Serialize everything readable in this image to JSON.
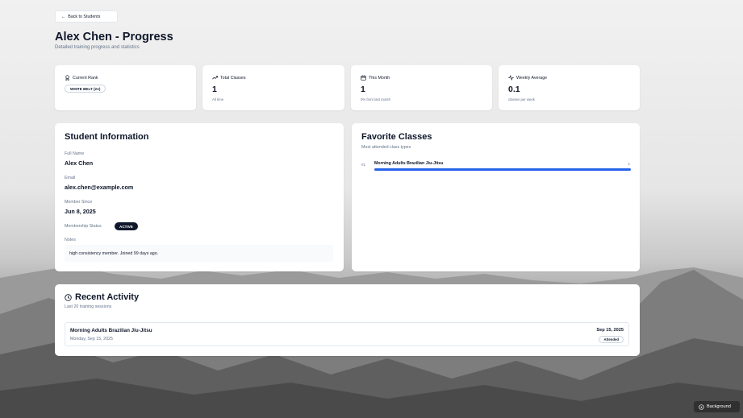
{
  "nav": {
    "back_label": "Back to Students"
  },
  "header": {
    "title": "Alex Chen - Progress",
    "subtitle": "Detailed training progress and statistics"
  },
  "stats": {
    "rank": {
      "title": "Current Rank",
      "badge": "WHITE BELT (2●)"
    },
    "total_classes": {
      "title": "Total Classes",
      "value": "1",
      "note": "All time"
    },
    "this_month": {
      "title": "This Month",
      "value": "1",
      "note": "0% from last month"
    },
    "weekly_average": {
      "title": "Weekly Average",
      "value": "0.1",
      "note": "classes per week"
    }
  },
  "student_info": {
    "title": "Student Information",
    "full_name_label": "Full Name",
    "full_name": "Alex Chen",
    "email_label": "Email",
    "email": "alex.chen@example.com",
    "member_since_label": "Member Since",
    "member_since": "Jun 8, 2025",
    "membership_status_label": "Membership Status",
    "membership_status": "ACTIVE",
    "notes_label": "Notes",
    "notes": "high consistency member. Joined 99 days ago."
  },
  "favorite_classes": {
    "title": "Favorite Classes",
    "subtitle": "Most attended class types",
    "items": [
      {
        "rank": "#1",
        "name": "Morning Adults Brazilian Jiu-Jitsu",
        "count": "1",
        "share": 1.0
      }
    ]
  },
  "recent_activity": {
    "title": "Recent Activity",
    "subtitle": "Last 20 training sessions",
    "items": [
      {
        "name": "Morning Adults Brazilian Jiu-Jitsu",
        "day": "Monday, Sep 15, 2025",
        "date": "Sep 15, 2025",
        "status": "Attended"
      }
    ]
  },
  "background_button": {
    "label": "Background"
  },
  "colors": {
    "accent": "#2563eb",
    "dark": "#0f172a",
    "muted": "#64748b"
  }
}
